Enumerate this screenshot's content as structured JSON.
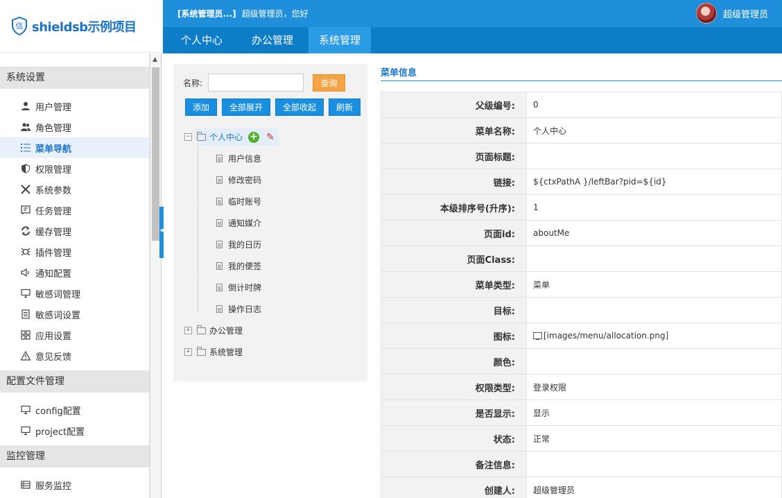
{
  "brand": {
    "logo_char": "信",
    "name": "shieldsb示例项目"
  },
  "topbar": {
    "system_name": "[系统管理员...]",
    "greeting": "超级管理员，您好",
    "user_name": "超级管理员"
  },
  "nav": [
    {
      "label": "个人中心"
    },
    {
      "label": "办公管理"
    },
    {
      "label": "系统管理",
      "active": true
    }
  ],
  "sidebar": {
    "sections": [
      {
        "title": "系统设置",
        "items": [
          {
            "label": "用户管理",
            "icon": "user-icon"
          },
          {
            "label": "角色管理",
            "icon": "users-icon"
          },
          {
            "label": "菜单导航",
            "icon": "list-icon",
            "active": true
          },
          {
            "label": "权限管理",
            "icon": "shield-icon"
          },
          {
            "label": "系统参数",
            "icon": "tools-icon"
          },
          {
            "label": "任务管理",
            "icon": "task-icon"
          },
          {
            "label": "缓存管理",
            "icon": "refresh-icon"
          },
          {
            "label": "插件管理",
            "icon": "bug-icon"
          },
          {
            "label": "通知配置",
            "icon": "speaker-icon"
          },
          {
            "label": "敏感词管理",
            "icon": "monitor-icon"
          },
          {
            "label": "敏感词设置",
            "icon": "doc-icon"
          },
          {
            "label": "应用设置",
            "icon": "grid-icon"
          },
          {
            "label": "意见反馈",
            "icon": "warning-icon"
          }
        ]
      },
      {
        "title": "配置文件管理",
        "items": [
          {
            "label": "config配置",
            "icon": "monitor-icon"
          },
          {
            "label": "project配置",
            "icon": "monitor-icon"
          }
        ]
      },
      {
        "title": "监控管理",
        "items": [
          {
            "label": "服务监控",
            "icon": "server-icon"
          }
        ]
      }
    ]
  },
  "tree_panel": {
    "search_label": "名称:",
    "search_value": "",
    "query_label": "查询",
    "buttons": [
      "添加",
      "全部展开",
      "全部收起",
      "刷新"
    ],
    "root": {
      "label": "个人中心",
      "expander": "−"
    },
    "children": [
      "用户信息",
      "修改密码",
      "临时账号",
      "通知媒介",
      "我的日历",
      "我的便签",
      "倒计时牌",
      "操作日志"
    ],
    "collapsed_nodes": [
      {
        "label": "办公管理",
        "expander": "+"
      },
      {
        "label": "系统管理",
        "expander": "+"
      }
    ]
  },
  "detail": {
    "title": "菜单信息",
    "rows": [
      {
        "key": "父级编号:",
        "value": "0"
      },
      {
        "key": "菜单名称:",
        "value": "个人中心"
      },
      {
        "key": "页面标题:",
        "value": ""
      },
      {
        "key": "链接:",
        "value": "${ctxPathA }/leftBar?pid=${id}"
      },
      {
        "key": "本级排序号(升序):",
        "value": "1"
      },
      {
        "key": "页面id:",
        "value": "aboutMe"
      },
      {
        "key": "页面Class:",
        "value": ""
      },
      {
        "key": "菜单类型:",
        "value": "菜单"
      },
      {
        "key": "目标:",
        "value": ""
      },
      {
        "key": "图标:",
        "value": "[images/menu/allocation.png]",
        "has_icon": true
      },
      {
        "key": "颜色:",
        "value": ""
      },
      {
        "key": "权限类型:",
        "value": "登录权限"
      },
      {
        "key": "是否显示:",
        "value": "显示"
      },
      {
        "key": "状态:",
        "value": "正常"
      },
      {
        "key": "备注信息:",
        "value": ""
      },
      {
        "key": "创建人:",
        "value": "超级管理员"
      }
    ]
  }
}
